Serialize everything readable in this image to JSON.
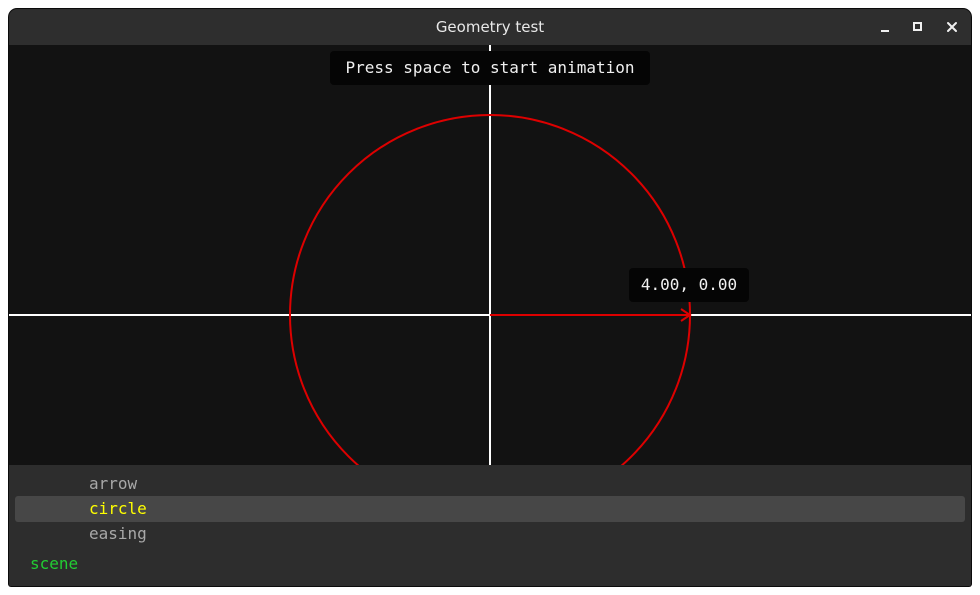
{
  "window": {
    "title": "Geometry test",
    "controls": {
      "minimize": "minimize-icon",
      "maximize": "maximize-icon",
      "close": "close-icon"
    }
  },
  "canvas": {
    "hint": "Press space to start animation",
    "coordinate_readout": "4.00, 0.00",
    "colors": {
      "background": "#121212",
      "axes": "#ffffff",
      "circle": "#dd0000",
      "arrow": "#dd0000"
    }
  },
  "scene_panel": {
    "items": [
      {
        "label": "arrow",
        "selected": false
      },
      {
        "label": "circle",
        "selected": true
      },
      {
        "label": "easing",
        "selected": false
      }
    ],
    "label": "scene",
    "colors": {
      "item": "#a8a8a8",
      "selected_item": "#ffff00",
      "selected_background": "#474747",
      "scene_label": "#22cc33"
    }
  }
}
